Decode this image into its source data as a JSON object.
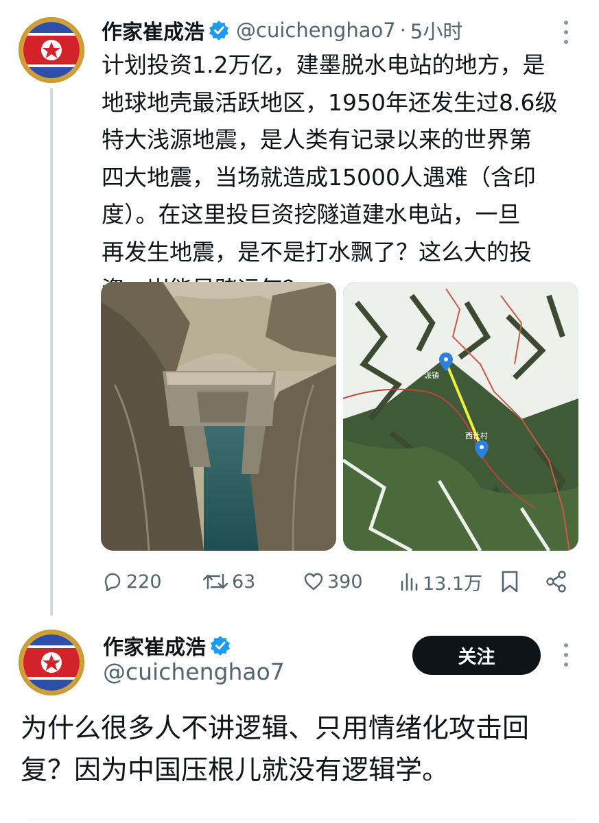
{
  "tweet": {
    "author_name": "作家崔成浩",
    "handle": "@cuichenghao7",
    "separator": "·",
    "time": "5小时",
    "text": "计划投资1.2万亿，建墨脱水电站的地方，是\n地球地壳最活跃地区，1950年还发生过8.6级\n特大浅源地震，是人类有记录以来的世界第\n四大地震，当场就造成15000人遇难（含印\n度）。在这里投巨资挖隧道建水电站，一旦\n再发生地震，是不是打水飘了？这么大的投\n资，岂能是赌运气？",
    "media": [
      {
        "icon": "dam-photo",
        "description_icon": "dam-canyon-image"
      },
      {
        "icon": "satellite-map",
        "map_labels": [
          "派镇",
          "西让村"
        ]
      }
    ],
    "actions": {
      "replies": "220",
      "retweets": "63",
      "likes": "390",
      "views": "13.1万"
    }
  },
  "profile": {
    "author_name": "作家崔成浩",
    "handle": "@cuichenghao7",
    "follow_label": "关注",
    "bio": "为什么很多人不讲逻辑、只用情绪化攻击回\n复？因为中国压根儿就没有逻辑学。"
  },
  "colors": {
    "text": "#0f1419",
    "muted": "#536471",
    "verified": "#1d9bf0",
    "follow_bg": "#0f1419"
  }
}
